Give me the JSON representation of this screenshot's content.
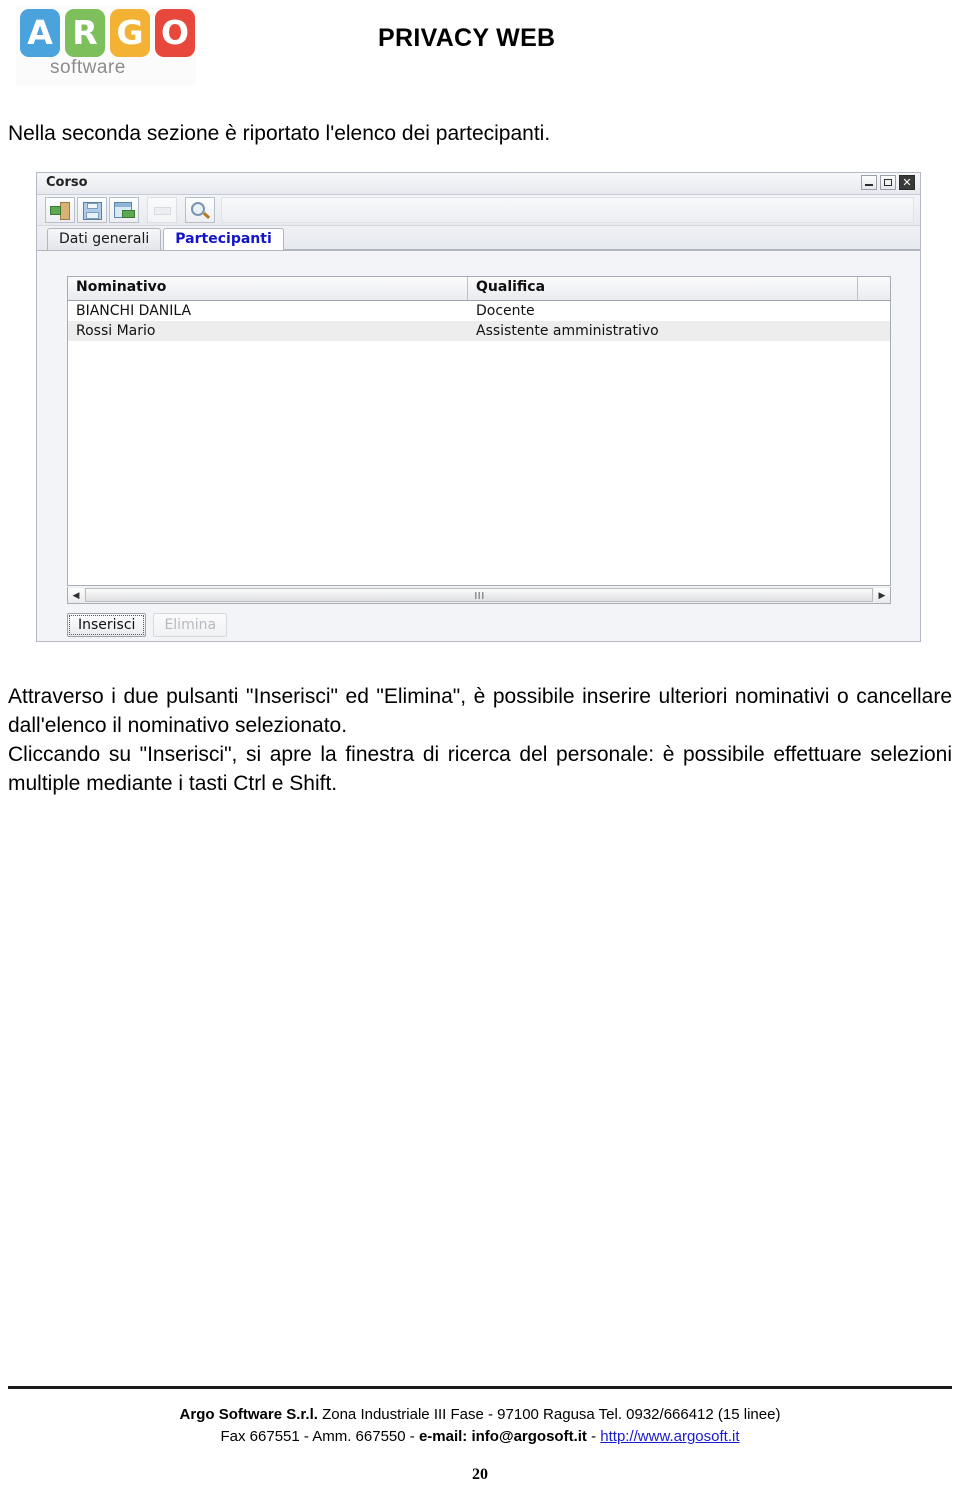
{
  "header": {
    "logo": {
      "tiles": [
        {
          "letter": "A",
          "color": "#4aa3dd"
        },
        {
          "letter": "R",
          "color": "#7dbf5a"
        },
        {
          "letter": "G",
          "color": "#f3b233"
        },
        {
          "letter": "O",
          "color": "#e8483c"
        }
      ],
      "word": "software"
    },
    "doc_title": "PRIVACY WEB"
  },
  "intro": {
    "text": "Nella seconda sezione è riportato l'elenco dei partecipanti."
  },
  "app_window": {
    "title": "Corso",
    "window_controls": [
      {
        "name": "minimize",
        "glyph": ""
      },
      {
        "name": "maximize",
        "glyph": ""
      },
      {
        "name": "close",
        "glyph": "✕"
      }
    ],
    "toolbar": {
      "buttons": [
        {
          "icon": "exit-door-icon",
          "enabled": true
        },
        {
          "icon": "save-floppy-icon",
          "enabled": true
        },
        {
          "icon": "insert-window-icon",
          "enabled": true
        },
        {
          "icon": "blank-disabled-icon",
          "enabled": false
        },
        {
          "icon": "search-magnifier-icon",
          "enabled": true
        }
      ]
    },
    "tabs": [
      {
        "label": "Dati generali",
        "active": false
      },
      {
        "label": "Partecipanti",
        "active": true
      }
    ],
    "grid": {
      "columns": [
        "Nominativo",
        "Qualifica",
        ""
      ],
      "rows": [
        [
          "BIANCHI DANILA",
          "Docente",
          ""
        ],
        [
          "Rossi Mario",
          "Assistente amministrativo",
          ""
        ]
      ]
    },
    "scrollbar": {
      "left_arrow": "◀",
      "right_arrow": "▶"
    },
    "buttons": {
      "insert": "Inserisci",
      "delete": "Elimina"
    }
  },
  "body": {
    "paragraph1": "Attraverso i due pulsanti \"Inserisci\" ed \"Elimina\", è possibile inserire ulteriori nominativi o cancellare dall'elenco il nominativo selezionato.",
    "paragraph2": "Cliccando su \"Inserisci\", si apre la finestra di ricerca del personale:  è possibile effettuare  selezioni multiple mediante i tasti Ctrl e Shift."
  },
  "footer": {
    "company": "Argo Software S.r.l.",
    "address": " Zona Industriale III Fase - 97100 Ragusa Tel. 0932/666412 (15 linee)",
    "fax_line_prefix": "Fax 667551 - Amm. 667550 - ",
    "email_label": "e-mail: info@argosoft.it",
    "separator": " - ",
    "url": "http://www.argosoft.it",
    "page_number": "20"
  }
}
